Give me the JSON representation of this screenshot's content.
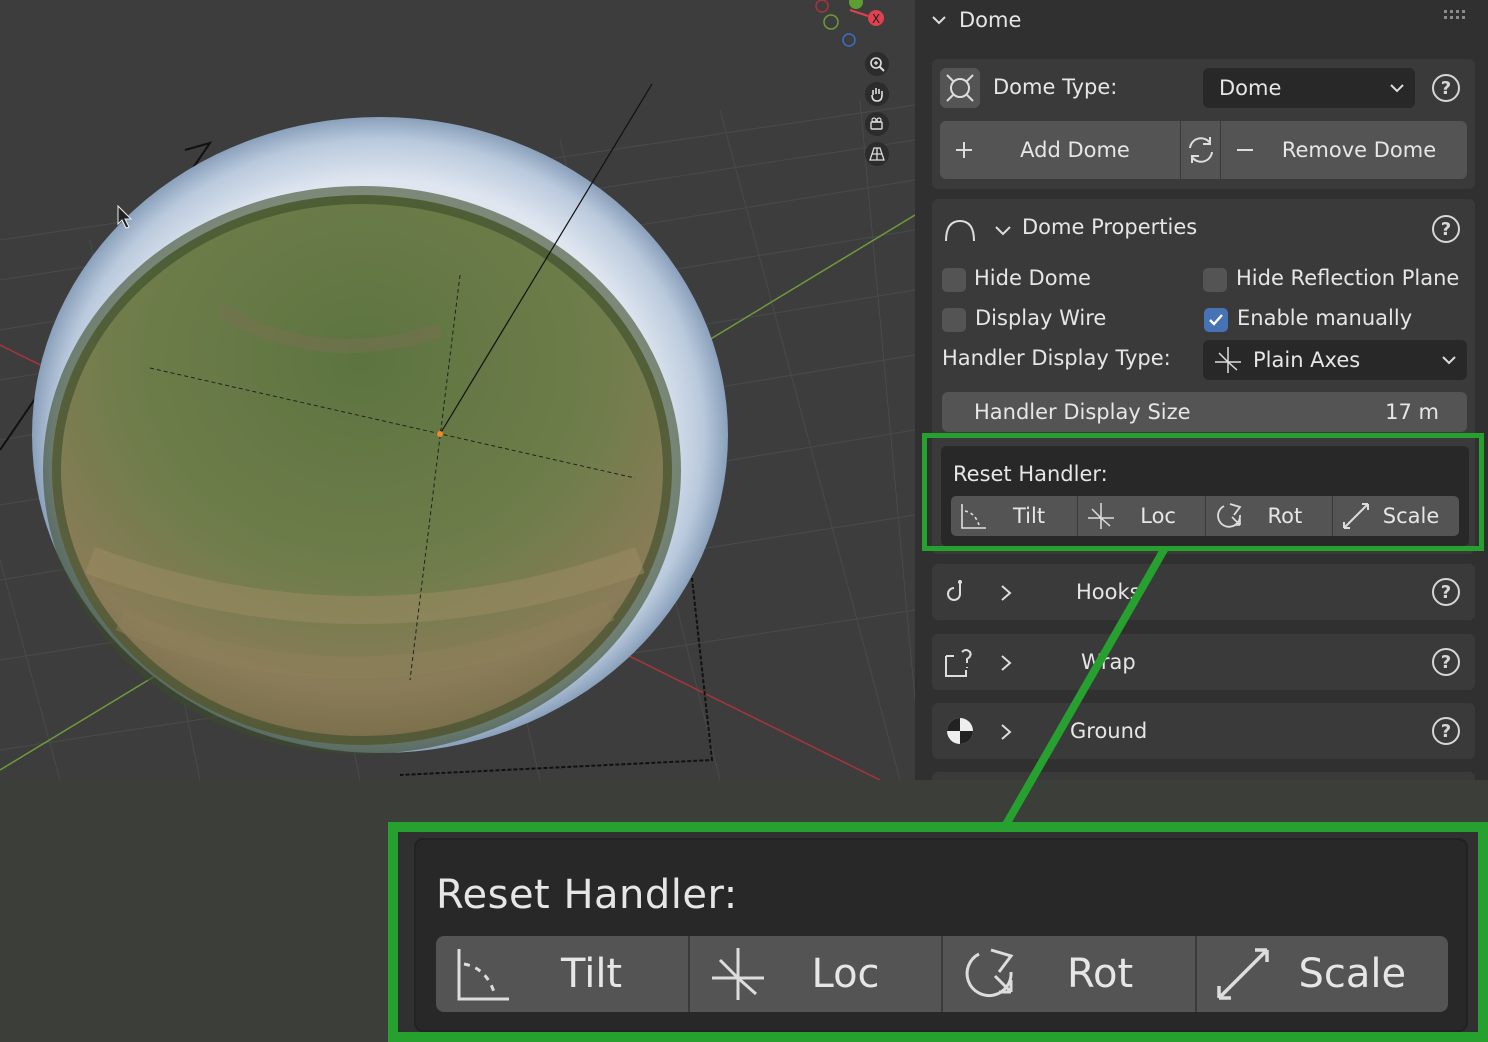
{
  "panel": {
    "title": "Dome",
    "dome_type_label": "Dome Type:",
    "dome_type_value": "Dome",
    "add_dome": "Add Dome",
    "remove_dome": "Remove Dome",
    "dome_properties": "Dome Properties",
    "checkboxes": {
      "hide_dome": {
        "label": "Hide Dome",
        "checked": false
      },
      "hide_reflection_plane": {
        "label": "Hide Reflection Plane",
        "checked": false
      },
      "display_wire": {
        "label": "Display Wire",
        "checked": false
      },
      "enable_manually": {
        "label": "Enable manually",
        "checked": true
      }
    },
    "handler_display_type_label": "Handler Display Type:",
    "handler_display_type_value": "Plain Axes",
    "handler_display_size_label": "Handler Display Size",
    "handler_display_size_value": "17 m",
    "reset_handler": {
      "title": "Reset Handler:",
      "buttons": [
        "Tilt",
        "Loc",
        "Rot",
        "Scale"
      ]
    },
    "sections": [
      "Hooks",
      "Wrap",
      "Ground"
    ]
  },
  "zoom": {
    "title": "Reset Handler:",
    "buttons": [
      "Tilt",
      "Loc",
      "Rot",
      "Scale"
    ]
  },
  "colors": {
    "highlight": "#26a12f",
    "checkbox_on": "#4772b3",
    "panel_bg": "#303030",
    "viewport_bg": "#3d3d3d"
  },
  "icons": {
    "nav": [
      "zoom-icon",
      "pan-hand-icon",
      "camera-icon",
      "perspective-grid-icon"
    ]
  }
}
